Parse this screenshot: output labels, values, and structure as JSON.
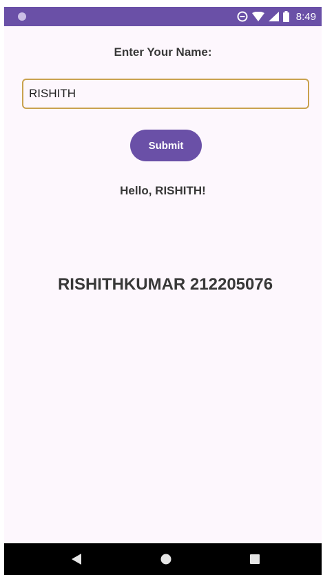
{
  "status_bar": {
    "time": "8:49",
    "background_color": "#6a50a7",
    "icons": [
      "notification-dot-icon",
      "do-not-disturb-icon",
      "wifi-icon",
      "cellular-signal-icon",
      "battery-icon"
    ]
  },
  "form": {
    "prompt_label": "Enter Your Name:",
    "name_input_value": "RISHITH",
    "submit_label": "Submit",
    "accent_color": "#6a50a7",
    "input_border_color": "#c9a24e"
  },
  "greeting": "Hello, RISHITH!",
  "footer_id": "RISHITHKUMAR 212205076",
  "nav_bar": {
    "icons": [
      "back-triangle-icon",
      "home-circle-icon",
      "recents-square-icon"
    ]
  }
}
